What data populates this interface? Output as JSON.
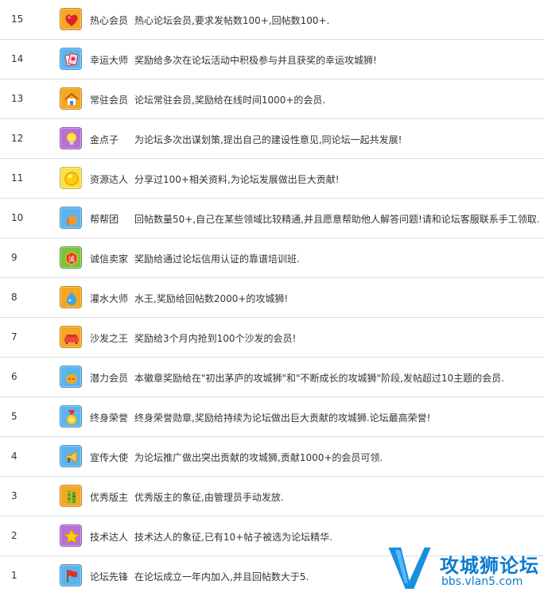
{
  "medals": [
    {
      "num": "15",
      "name": "热心会员",
      "desc": "热心论坛会员,要求发帖数100+,回帖数100+.",
      "icon": "heart-icon",
      "color": "#f5a623"
    },
    {
      "num": "14",
      "name": "幸运大师",
      "desc": "奖励给多次在论坛活动中积极参与并且获奖的幸运攻城狮!",
      "icon": "lucky-cards-icon",
      "color": "#5bb4f0"
    },
    {
      "num": "13",
      "name": "常驻会员",
      "desc": "论坛常驻会员,奖励给在线时间1000+的会员.",
      "icon": "house-icon",
      "color": "#f5a623"
    },
    {
      "num": "12",
      "name": "金点子",
      "desc": "为论坛多次出谋划策,提出自己的建设性意见,同论坛一起共发展!",
      "icon": "lightbulb-icon",
      "color": "#b86fd6"
    },
    {
      "num": "11",
      "name": "资源达人",
      "desc": "分享过100+相关资料,为论坛发展做出巨大贡献!",
      "icon": "sun-coin-icon",
      "color": "#f7e04a"
    },
    {
      "num": "10",
      "name": "帮帮团",
      "desc": "回帖数量50+,自己在某些领域比较精通,并且愿意帮助他人解答问题!请和论坛客服联系手工领取.",
      "icon": "thumbs-up-icon",
      "color": "#5bb4f0"
    },
    {
      "num": "9",
      "name": "诚信卖家",
      "desc": "奖励给通过论坛信用认证的靠谱培训班.",
      "icon": "honesty-seal-icon",
      "color": "#7cc242"
    },
    {
      "num": "8",
      "name": "灌水大师",
      "desc": "水王,奖励给回帖数2000+的攻城狮!",
      "icon": "water-drop-icon",
      "color": "#f5a623"
    },
    {
      "num": "7",
      "name": "沙发之王",
      "desc": "奖励给3个月内抢到100个沙发的会员!",
      "icon": "sofa-icon",
      "color": "#f5a623"
    },
    {
      "num": "6",
      "name": "潜力会员",
      "desc": "本徽章奖励给在\"初出茅庐的攻城狮\"和\"不断成长的攻城狮\"阶段,发帖超过10主题的会员.",
      "icon": "sprout-icon",
      "color": "#5bb4f0"
    },
    {
      "num": "5",
      "name": "终身荣誉",
      "desc": "终身荣誉勋章,奖励给持续为论坛做出巨大贡献的攻城狮.论坛最高荣誉!",
      "icon": "medal-icon",
      "color": "#5bb4f0"
    },
    {
      "num": "4",
      "name": "宣传大使",
      "desc": "为论坛推广做出突出贡献的攻城狮,贡献1000+的会员可领.",
      "icon": "megaphone-icon",
      "color": "#5bb4f0"
    },
    {
      "num": "3",
      "name": "优秀版主",
      "desc": "优秀版主的象征,由管理员手动发放.",
      "icon": "bamboo-icon",
      "color": "#f5a623"
    },
    {
      "num": "2",
      "name": "技术达人",
      "desc": "技术达人的象征,已有10+帖子被选为论坛精华.",
      "icon": "star-icon",
      "color": "#b86fd6"
    },
    {
      "num": "1",
      "name": "论坛先锋",
      "desc": "在论坛成立一年内加入,并且回帖数大于5.",
      "icon": "flag-icon",
      "color": "#5bb4f0"
    }
  ],
  "watermark": {
    "brand": "攻城狮论坛",
    "url": "bbs.vlan5.com",
    "mark": "V5"
  }
}
